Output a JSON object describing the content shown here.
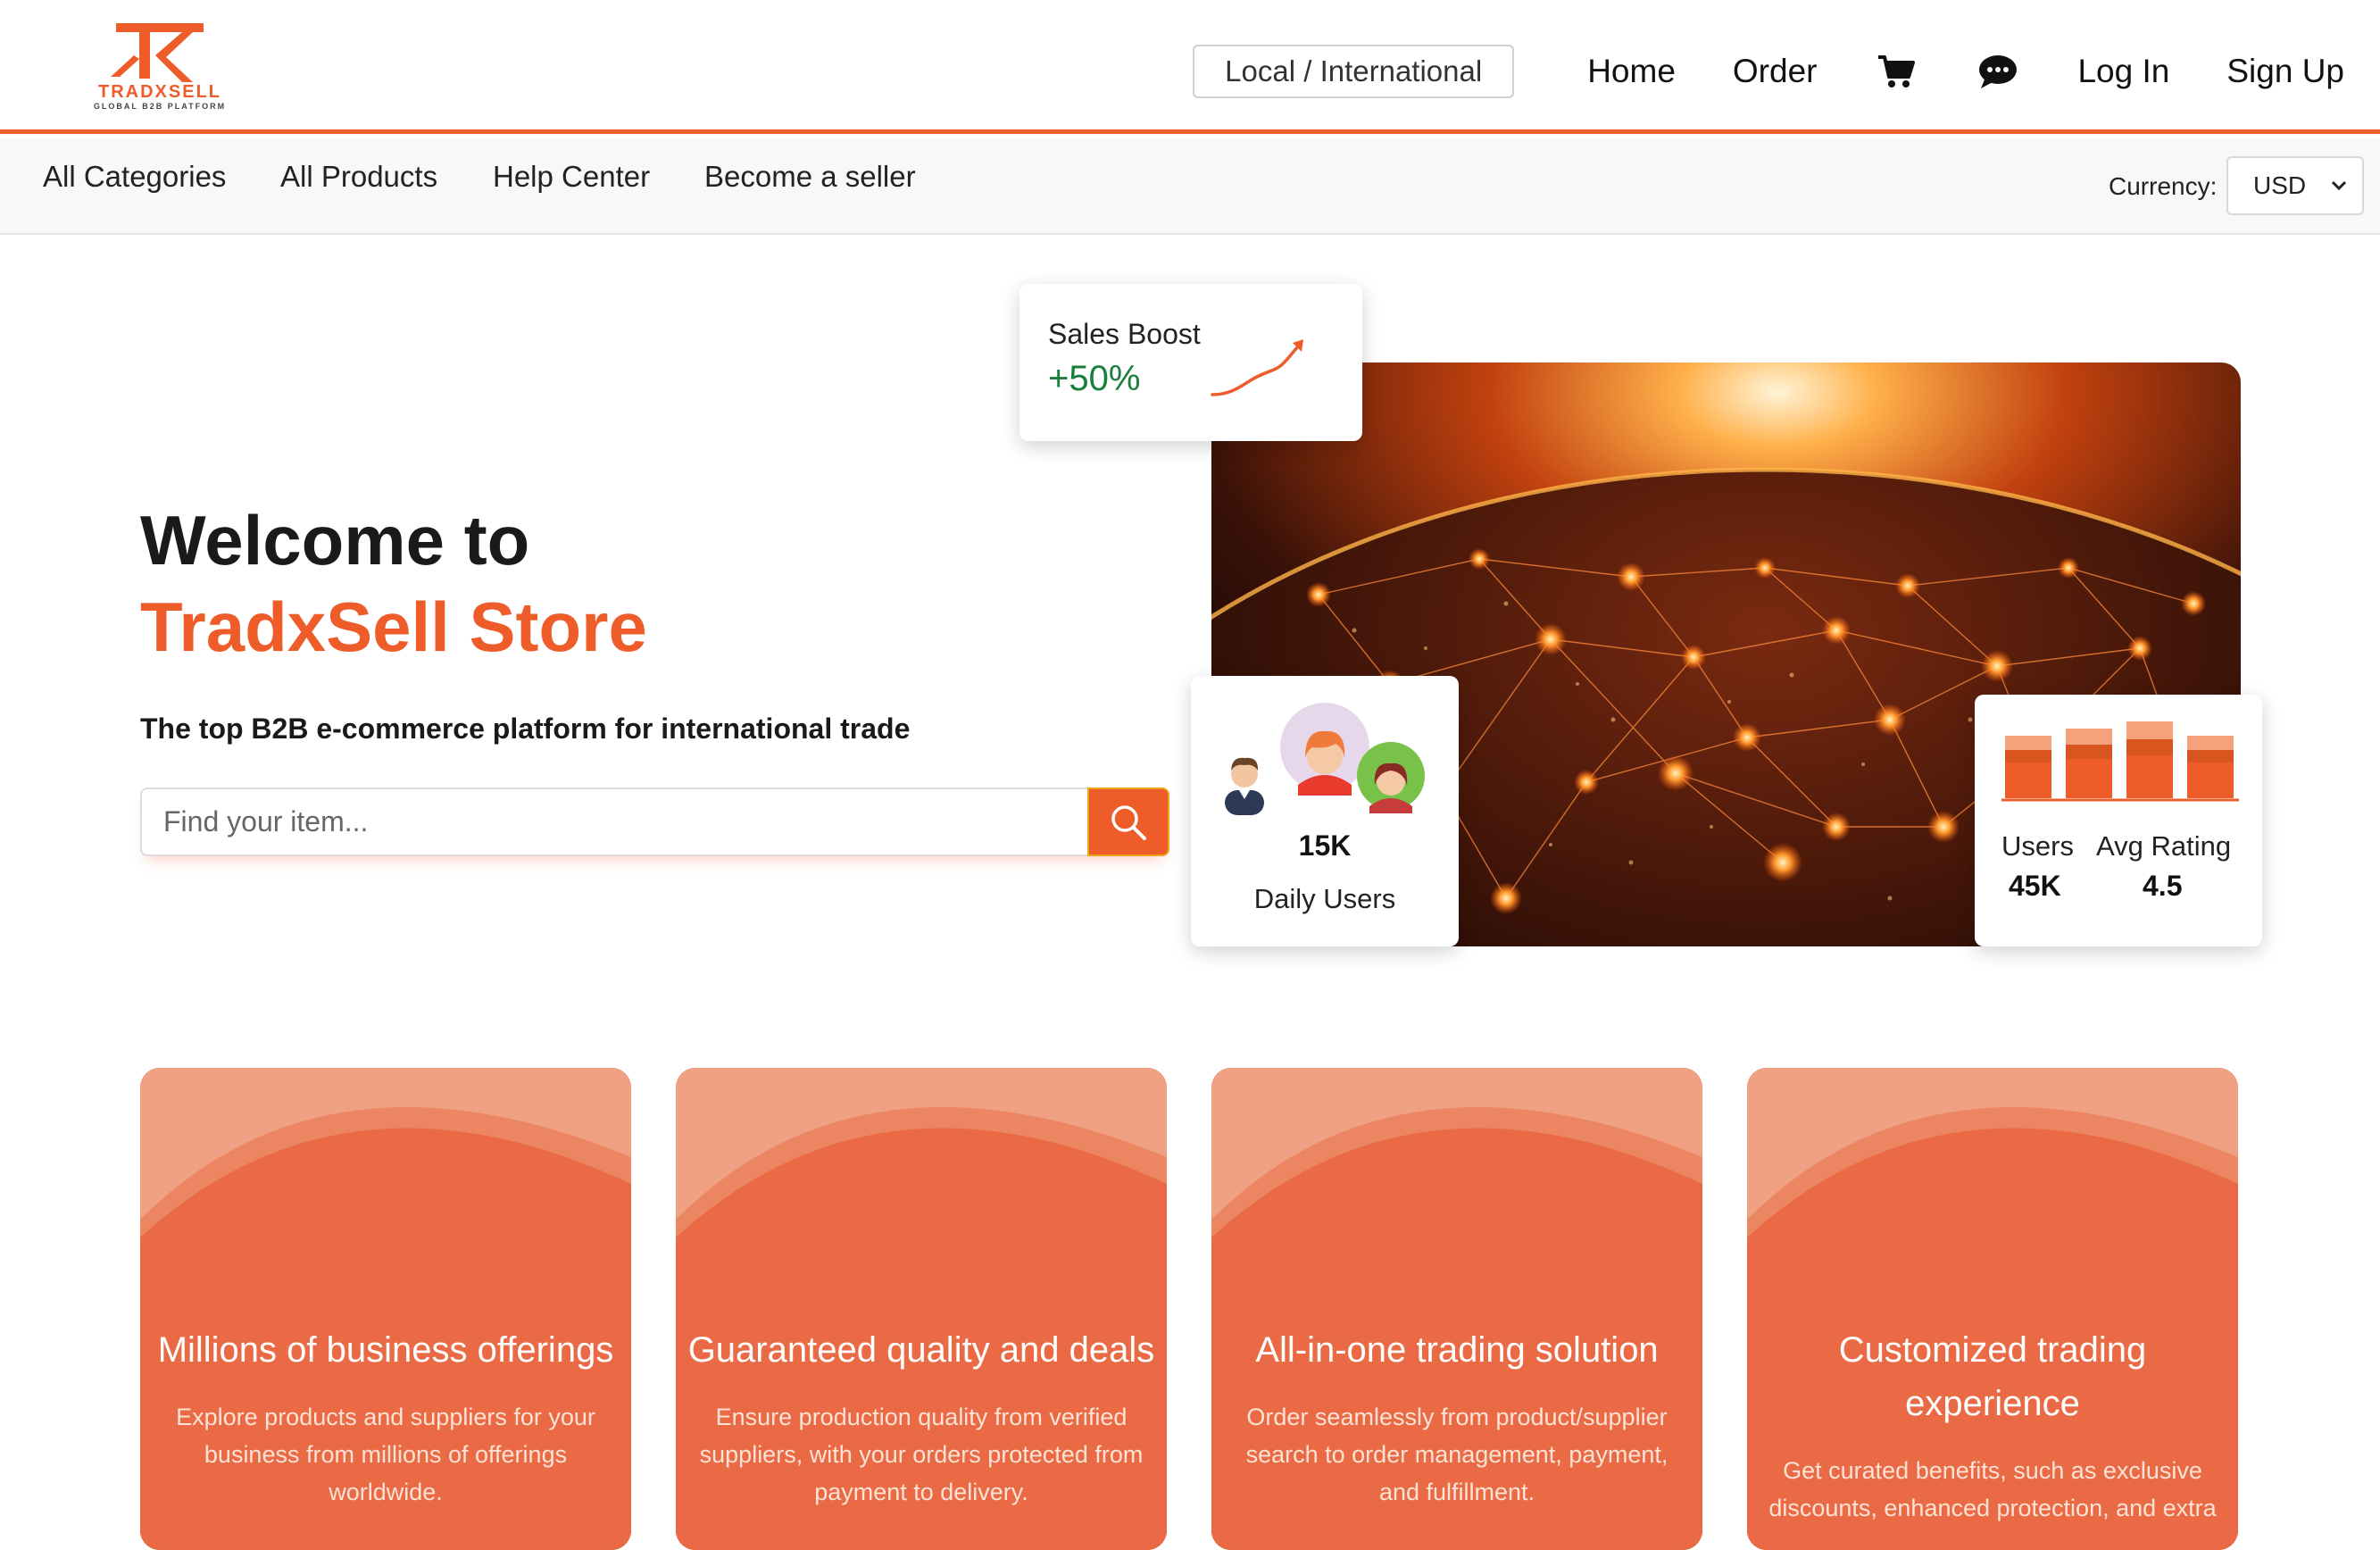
{
  "brand": {
    "name": "TRADXSELL",
    "tagline": "GLOBAL B2B PLATFORM",
    "accent": "#ee5c2a"
  },
  "header": {
    "region_toggle": "Local / International",
    "nav": {
      "home": "Home",
      "order": "Order",
      "login": "Log In",
      "signup": "Sign Up"
    },
    "icons": [
      "cart-icon",
      "chat-icon"
    ]
  },
  "subnav": {
    "items": [
      "All Categories",
      "All Products",
      "Help Center",
      "Become a seller"
    ],
    "currency_label": "Currency:",
    "currency_value": "USD"
  },
  "hero": {
    "title_line1": "Welcome to",
    "title_line2": "TradxSell Store",
    "subtitle": "The top B2B e-commerce platform for international trade",
    "search_placeholder": "Find your item..."
  },
  "stats": {
    "sales_boost_label": "Sales Boost",
    "sales_boost_value": "+50%",
    "daily_users_value": "15K",
    "daily_users_label": "Daily Users",
    "users_label": "Users",
    "users_value": "45K",
    "rating_label": "Avg Rating",
    "rating_value": "4.5"
  },
  "features": [
    {
      "title": "Millions of business offerings",
      "desc": "Explore products and suppliers for your business from millions of offerings worldwide."
    },
    {
      "title": "Guaranteed quality and deals",
      "desc": "Ensure production quality from verified suppliers, with your orders protected from payment to delivery."
    },
    {
      "title": "All-in-one trading solution",
      "desc": "Order seamlessly from product/supplier search to order management, payment, and fulfillment."
    },
    {
      "title": "Customized trading experience",
      "desc": "Get curated benefits, such as exclusive discounts, enhanced protection, and extra"
    }
  ]
}
